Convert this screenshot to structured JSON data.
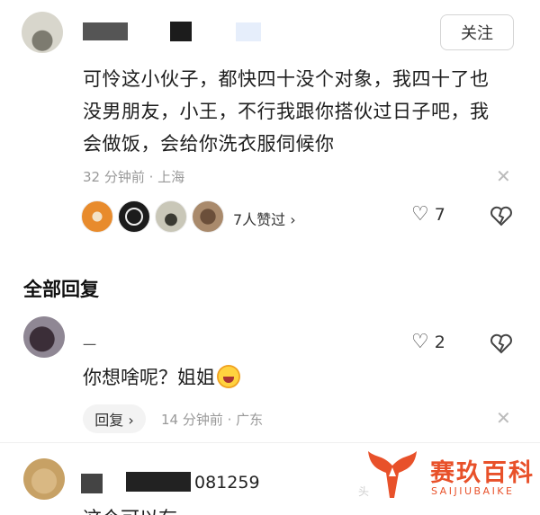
{
  "comment": {
    "follow_label": "关注",
    "text": "可怜这小伙子，都快四十没个对象，我四十了也没男朋友，小王，不行我跟你搭伙过日子吧，我会做饭，会给你洗衣服伺候你",
    "meta": "32 分钟前 · 上海",
    "likes_link": "7人赞过 ›",
    "like_count": "7"
  },
  "replies_section": {
    "title": "全部回复"
  },
  "reply1": {
    "name": "一",
    "text": "你想啥呢？姐姐",
    "like_count": "2",
    "reply_button": "回复 ›",
    "meta": "14 分钟前 · 广东"
  },
  "reply2": {
    "id_suffix": "081259",
    "text": "这个可以有"
  },
  "watermark": {
    "title": "赛玖百科",
    "subtitle": "SAIJIUBAIKE",
    "ghost": "头"
  },
  "colors": {
    "brand_orange": "#e8512a",
    "meta_gray": "#999999"
  }
}
